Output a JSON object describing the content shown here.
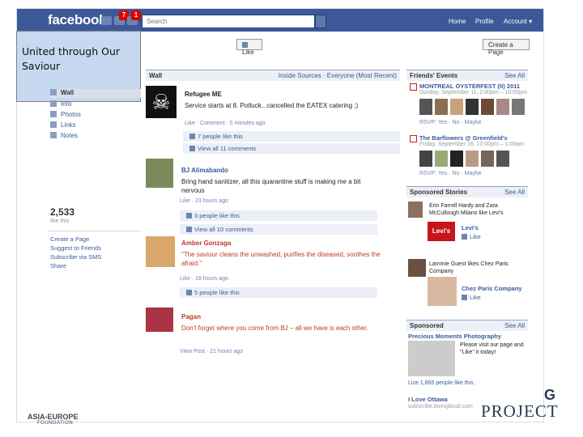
{
  "header": {
    "logo": "facebook",
    "notifications": [
      "7",
      "1"
    ],
    "search_placeholder": "Search",
    "nav": [
      "Home",
      "Profile",
      "Account ▾"
    ]
  },
  "caption": "United through Our Saviour",
  "page_actions": {
    "like": "Like",
    "create_page": "Create a Page"
  },
  "sidebar": {
    "items": [
      "Wall",
      "Info",
      "Photos",
      "Links",
      "Notes"
    ],
    "likes_count": "2,533",
    "likes_label": "like this",
    "links": [
      "Create a Page",
      "Suggest to Friends",
      "Subscribe via SMS",
      "Share"
    ]
  },
  "wall": {
    "title": "Wall",
    "filter": "Inside Sources · Everyone (Most Recent)",
    "posts": [
      {
        "name": "Refugee ME",
        "text": "Service starts at 8. Potluck...cancelled the EATEX catering ;)",
        "meta": "Like · Comment · 5 minutes ago",
        "likes": "7 people like this",
        "comments": "View all 11 comments"
      },
      {
        "name": "BJ Alimabando",
        "text": "Bring hand sanitizer, all this quarantine stuff is making me a bit nervous",
        "meta": "Like · 23 hours ago",
        "likes": "3 people like this",
        "comments": "View all 10 comments"
      },
      {
        "name": "Amber Gonzaga",
        "text": "\"The saviour cleans the unwashed, purifies the diseased, soothes the afraid.\"",
        "meta": "Like · 18 hours ago",
        "likes": "5 people like this"
      },
      {
        "name": "Pagan",
        "text": "Don't forget where you come from BJ – all we have is each other.",
        "meta": "View Post · 21 hours ago"
      }
    ]
  },
  "right_column": {
    "events_title": "Friends' Events",
    "see_all": "See All",
    "events": [
      {
        "title": "MONTREAL OYSTERFEST (II) 2011",
        "date": "Sunday, September 11, 2:00pm – 10:00pm",
        "rsvp": "RSVP: Yes · No · Maybe"
      },
      {
        "title": "The Barflowers @ Greenfield's",
        "date": "Friday, September 16, 10:00pm – 1:00am",
        "rsvp": "RSVP: Yes · No · Maybe"
      }
    ],
    "sponsored_title": "Sponsored Stories",
    "sponsored_stories": [
      {
        "text": "Erin Farrell Hardy and Zara McCullough Milano like Levi's",
        "brand": "Levi's",
        "action": "Like"
      },
      {
        "text": "Lammie Guest likes Chez Paris Company",
        "brand": "Chez Paris Company",
        "action": "Like"
      }
    ],
    "ads_title": "Sponsored",
    "ads": [
      {
        "title": "Precious Moments Photography",
        "text": "Please visit our page and \"Like\" it today!",
        "likes": "Lize 1,865 people like this."
      },
      {
        "title": "I Love Ottawa",
        "text": "subscribe.lovinglocal.com"
      }
    ]
  },
  "footer": {
    "logo": "ASIA-EUROPE",
    "sub": "FOUNDATION",
    "project_tag": "G",
    "project": "PROJECT"
  }
}
